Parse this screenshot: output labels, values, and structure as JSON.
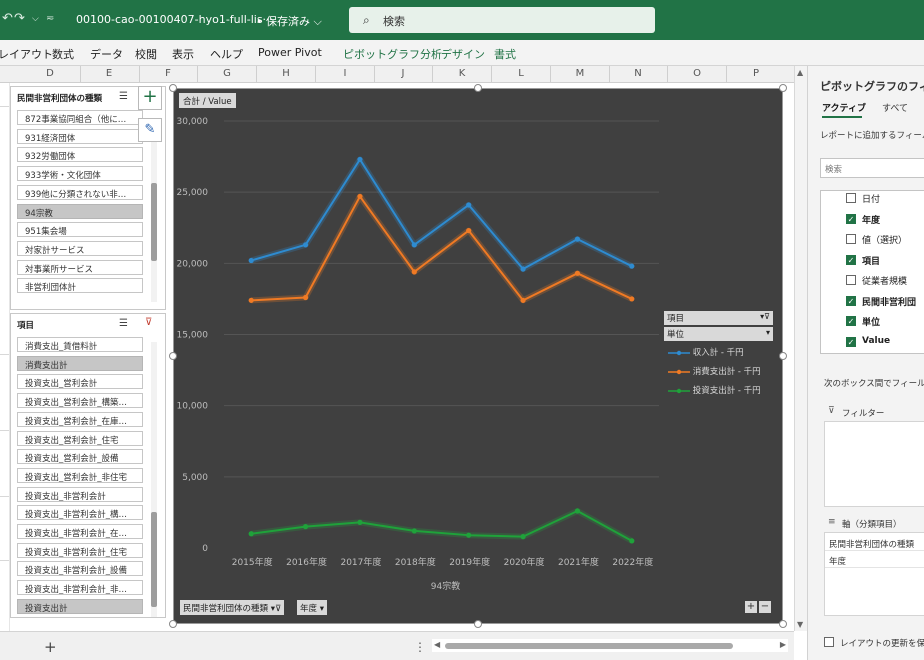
{
  "titlebar": {
    "doc_title": "00100-cao-00100407-hyo1-full-lis···",
    "saved_label": "• 保存済み ⌵",
    "search_placeholder": "検索",
    "search_icon": "search-icon",
    "undo_icon": "undo-icon",
    "redo_icon": "redo-icon",
    "qat_icon": "customize-icon"
  },
  "ribbon": {
    "tabs": [
      "レイアウト",
      "数式",
      "データ",
      "校閲",
      "表示",
      "ヘルプ",
      "Power Pivot"
    ],
    "context_tabs": [
      "ピボットグラフ分析",
      "デザイン",
      "書式"
    ]
  },
  "columns": [
    "D",
    "E",
    "F",
    "G",
    "H",
    "I",
    "J",
    "K",
    "L",
    "M",
    "N",
    "O",
    "P"
  ],
  "slicer1": {
    "title": "民間非営利団体の種類",
    "items": [
      {
        "label": "872事業協同組合（他に…",
        "selected": false
      },
      {
        "label": "931経済団体",
        "selected": false
      },
      {
        "label": "932労働団体",
        "selected": false
      },
      {
        "label": "933学術・文化団体",
        "selected": false
      },
      {
        "label": "939他に分類されない非…",
        "selected": false
      },
      {
        "label": "94宗教",
        "selected": true
      },
      {
        "label": "951集会場",
        "selected": false
      },
      {
        "label": "対家計サービス",
        "selected": false
      },
      {
        "label": "対事業所サービス",
        "selected": false
      },
      {
        "label": "非営利団体計",
        "selected": false
      }
    ]
  },
  "slicer2": {
    "title": "項目",
    "items": [
      {
        "label": "消費支出_賃借料計",
        "selected": false
      },
      {
        "label": "消費支出計",
        "selected": true
      },
      {
        "label": "投資支出_営利会計",
        "selected": false
      },
      {
        "label": "投資支出_営利会計_構築…",
        "selected": false
      },
      {
        "label": "投資支出_営利会計_在庫…",
        "selected": false
      },
      {
        "label": "投資支出_営利会計_住宅",
        "selected": false
      },
      {
        "label": "投資支出_営利会計_設備",
        "selected": false
      },
      {
        "label": "投資支出_営利会計_非住宅",
        "selected": false
      },
      {
        "label": "投資支出_非営利会計",
        "selected": false
      },
      {
        "label": "投資支出_非営利会計_構…",
        "selected": false
      },
      {
        "label": "投資支出_非営利会計_在…",
        "selected": false
      },
      {
        "label": "投資支出_非営利会計_住宅",
        "selected": false
      },
      {
        "label": "投資支出_非営利会計_設備",
        "selected": false
      },
      {
        "label": "投資支出_非営利会計_非…",
        "selected": false
      },
      {
        "label": "投資支出計",
        "selected": true
      }
    ]
  },
  "chart_buttons": {
    "value_field": "合計 / Value",
    "axis_field_1": "民間非営利団体の種類",
    "axis_field_2": "年度",
    "legend_field_1": "項目",
    "legend_field_2": "単位",
    "expand_plus": "+",
    "expand_minus": "−"
  },
  "chart_data": {
    "type": "line",
    "title": "",
    "xlabel": "94宗教",
    "ylabel": "",
    "categories": [
      "2015年度",
      "2016年度",
      "2017年度",
      "2018年度",
      "2019年度",
      "2020年度",
      "2021年度",
      "2022年度"
    ],
    "ylim": [
      0,
      30000
    ],
    "yticks": [
      "0",
      "5,000",
      "10,000",
      "15,000",
      "20,000",
      "25,000",
      "30,000"
    ],
    "grid": true,
    "legend_position": "right",
    "series": [
      {
        "name": "収入計 - 千円",
        "color": "#2e8bd0",
        "values": [
          20200,
          21300,
          27300,
          21300,
          24100,
          19600,
          21700,
          19800
        ]
      },
      {
        "name": "消費支出計 - 千円",
        "color": "#f07a24",
        "values": [
          17400,
          17600,
          24700,
          19400,
          22300,
          17400,
          19300,
          17500
        ]
      },
      {
        "name": "投資支出計 - 千円",
        "color": "#1fa23a",
        "values": [
          1000,
          1500,
          1800,
          1200,
          900,
          800,
          2600,
          500
        ]
      }
    ]
  },
  "pane": {
    "title": "ピボットグラフのフィー",
    "tab_active": "アクティブ",
    "tab_all": "すべて",
    "prompt": "レポートに追加するフィール",
    "search_placeholder": "検索",
    "fields": [
      {
        "label": "日付",
        "checked": false
      },
      {
        "label": "年度",
        "checked": true
      },
      {
        "label": "値（選択）",
        "checked": false
      },
      {
        "label": "項目",
        "checked": true
      },
      {
        "label": "従業者規模",
        "checked": false
      },
      {
        "label": "民間非営利団",
        "checked": true
      },
      {
        "label": "単位",
        "checked": true
      },
      {
        "label": "Value",
        "checked": true
      }
    ],
    "drag_prompt": "次のボックス間でフィールド",
    "filter_label": "フィルター",
    "axis_label": "軸（分類項目）",
    "axis_items": [
      "民間非営利団体の種類",
      "年度"
    ],
    "defer_label": "レイアウトの更新を保",
    "filter_icon": "filter-icon",
    "axis_icon": "axis-icon"
  },
  "sheetbar": {
    "add_label": "+",
    "more_label": "⋮"
  }
}
